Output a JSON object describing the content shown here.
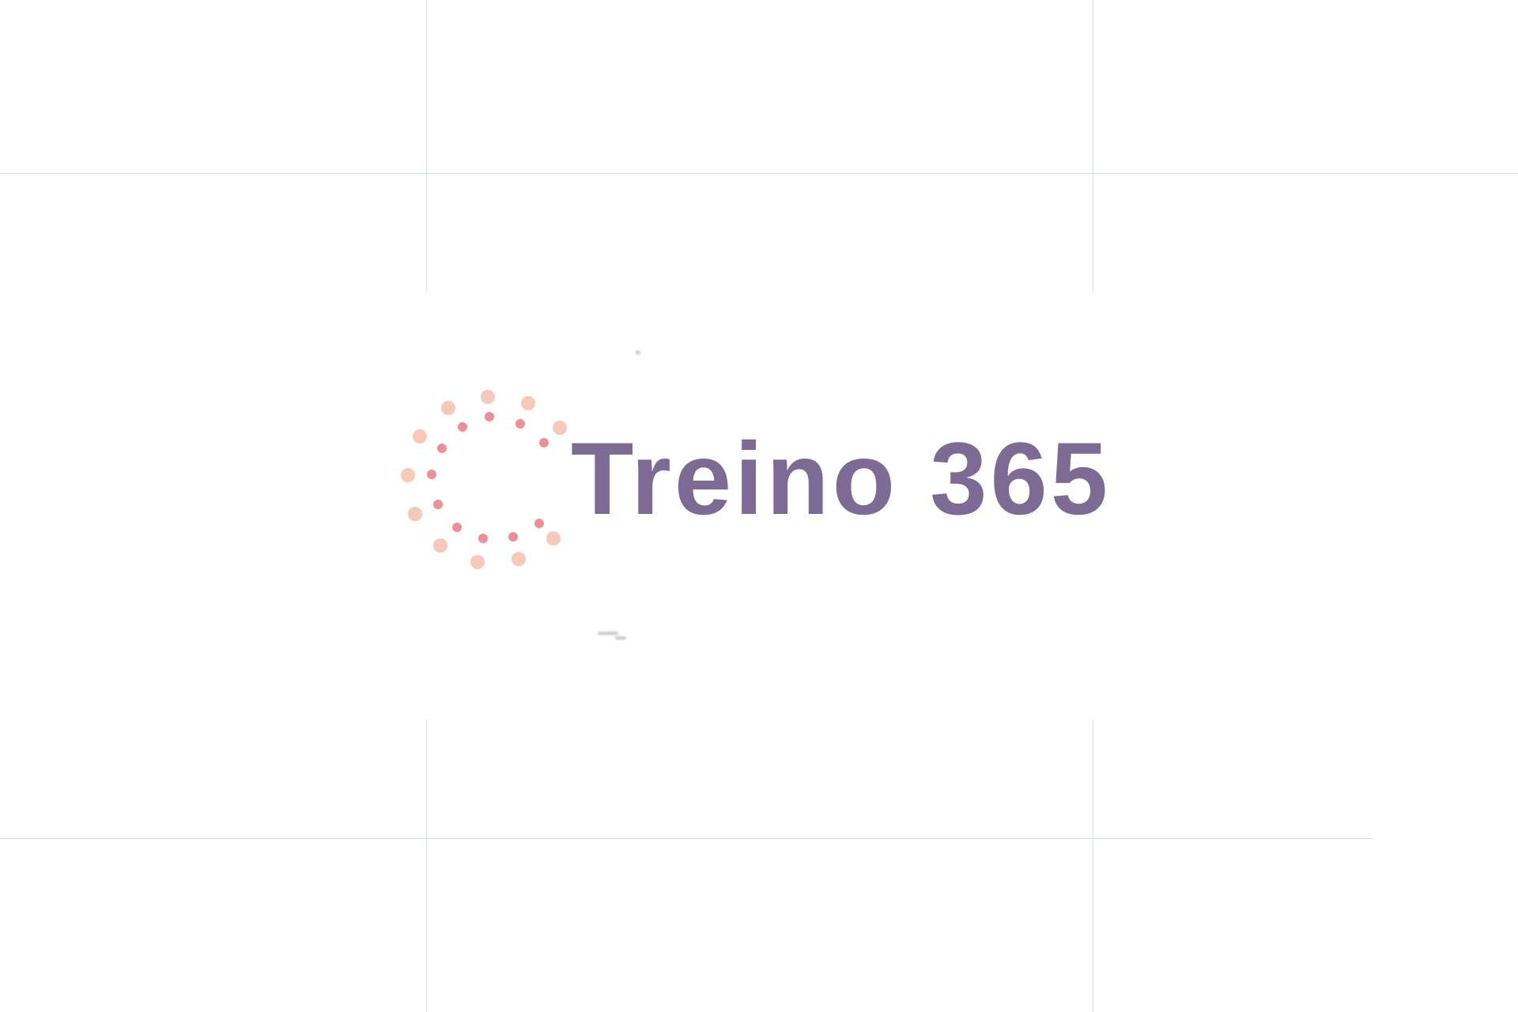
{
  "brand": {
    "name": "Treino 365"
  },
  "colors": {
    "wordmark": "#7e6b95",
    "dot_outer": "#f7c9b8",
    "dot_inner": "#f08e96",
    "guide_line": "#cfe0f3",
    "background": "#ffffff"
  },
  "icons": {
    "logo_mark": "dotted-circle-burst-icon"
  }
}
